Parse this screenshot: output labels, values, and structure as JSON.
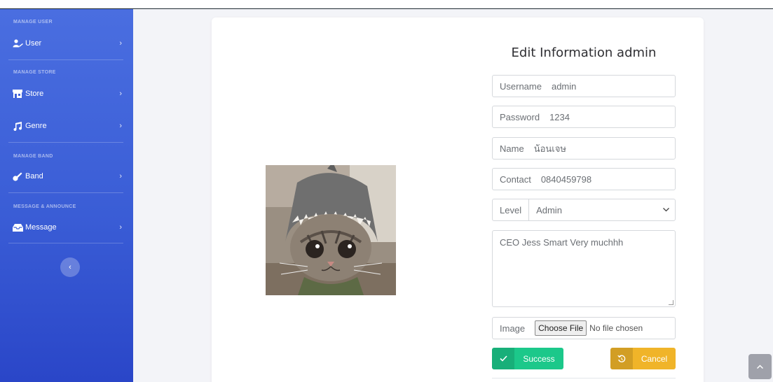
{
  "sidebar": {
    "sections": [
      {
        "heading": "MANAGE USER"
      },
      {
        "heading": "MANAGE STORE"
      },
      {
        "heading": "MANAGE BAND"
      },
      {
        "heading": "MESSAGE & ANNOUNCE"
      }
    ],
    "items": [
      {
        "label": "User",
        "icon": "user-icon"
      },
      {
        "label": "Store",
        "icon": "store-icon"
      },
      {
        "label": "Genre",
        "icon": "music-icon"
      },
      {
        "label": "Band",
        "icon": "guitar-icon"
      },
      {
        "label": "Message",
        "icon": "inbox-icon"
      }
    ],
    "chevron": "›",
    "toggle": "‹"
  },
  "form": {
    "title": "Edit Information admin",
    "username": {
      "label": "Username",
      "value": "admin"
    },
    "password": {
      "label": "Password",
      "value": "1234"
    },
    "name": {
      "label": "Name",
      "value": "น้อนเจษ"
    },
    "contact": {
      "label": "Contact",
      "value": "0840459798"
    },
    "level": {
      "label": "Level",
      "value": "Admin"
    },
    "bio": "CEO Jess Smart Very muchhh",
    "image": {
      "label": "Image",
      "button": "Choose File",
      "status": "No file chosen"
    },
    "success_label": "Success",
    "cancel_label": "Cancel"
  },
  "colors": {
    "sidebar_top": "#4a6ee0",
    "sidebar_bottom": "#2a46c8",
    "success": "#1cc88a",
    "cancel": "#f0b429"
  }
}
